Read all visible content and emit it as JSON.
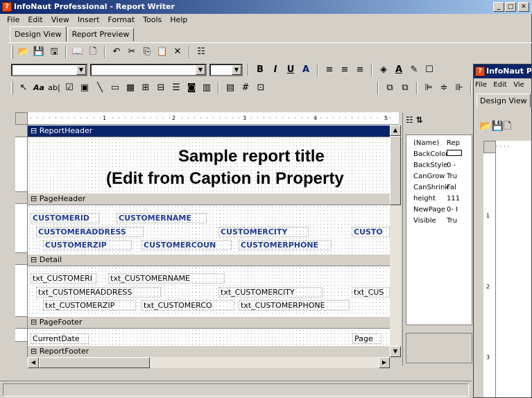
{
  "window": {
    "title": "InfoNaut Professional - Report Writer",
    "min": "_",
    "max": "□",
    "close": "✕"
  },
  "menu": [
    "File",
    "Edit",
    "View",
    "Insert",
    "Format",
    "Tools",
    "Help"
  ],
  "tabs": [
    "Design View",
    "Report Preview"
  ],
  "ruler": {
    "marks": [
      "1",
      "2",
      "3",
      "4",
      "5"
    ]
  },
  "bands": {
    "report_header": "ReportHeader",
    "page_header": "PageHeader",
    "detail": "Detail",
    "page_footer": "PageFooter",
    "report_footer": "ReportFooter"
  },
  "report_title": {
    "line1": "Sample report title",
    "line2": "(Edit from Caption in Property"
  },
  "page_header_fields": [
    "CUSTOMERID",
    "CUSTOMERNAME",
    "CUSTOMERADDRESS",
    "CUSTOMERCITY",
    "CUSTO",
    "CUSTOMERZIP",
    "CUSTOMERCOUN",
    "CUSTOMERPHONE"
  ],
  "detail_fields": [
    "txt_CUSTOMERI",
    "txt_CUSTOMERNAME",
    "txt_CUSTOMERADDRESS",
    "txt_CUSTOMERCITY",
    "txt_CUS",
    "txt_CUSTOMERZIP",
    "txt_CUSTOMERCO",
    "txt_CUSTOMERPHONE"
  ],
  "footer_fields": [
    "CurrentDate",
    "Page"
  ],
  "properties": [
    {
      "name": "(Name)",
      "value": "Rep"
    },
    {
      "name": "BackColor",
      "value": ""
    },
    {
      "name": "BackStyle",
      "value": "0 -"
    },
    {
      "name": "CanGrow",
      "value": "Tru"
    },
    {
      "name": "CanShrink",
      "value": "Fal"
    },
    {
      "name": "height",
      "value": "111"
    },
    {
      "name": "NewPage",
      "value": "0- I"
    },
    {
      "name": "Visible",
      "value": "Tru"
    }
  ],
  "second_window": {
    "title": "InfoNaut P",
    "menu": [
      "File",
      "Edit",
      "Vie"
    ],
    "tab": "Design View",
    "ruler_marks": [
      "1",
      "2",
      "3"
    ]
  }
}
